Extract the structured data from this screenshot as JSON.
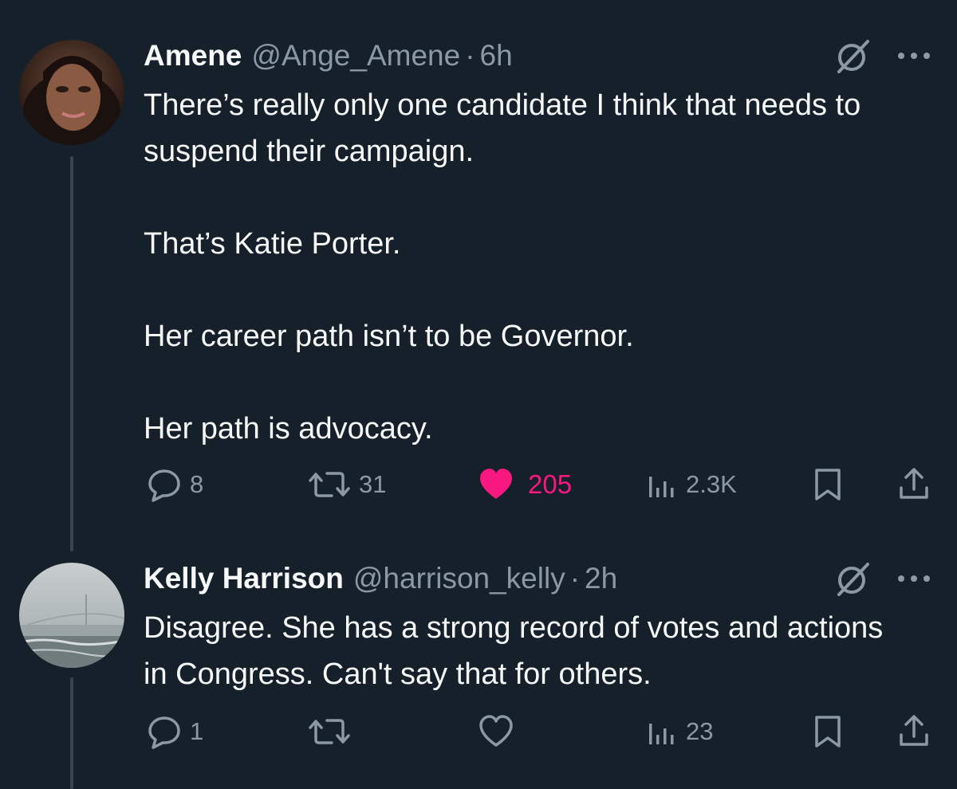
{
  "tweets": [
    {
      "name": "Amene",
      "handle": "@Ange_Amene",
      "separator": "·",
      "time": "6h",
      "paragraphs": [
        "There’s really only one candidate I think that needs to suspend their campaign.",
        "That’s Katie Porter.",
        "Her career path isn’t to be Governor.",
        "Her path is advocacy."
      ],
      "replies": "8",
      "reposts": "31",
      "likes": "205",
      "liked": true,
      "views": "2.3K"
    },
    {
      "name": "Kelly Harrison",
      "handle": "@harrison_kelly",
      "separator": "·",
      "time": "2h",
      "paragraphs": [
        "Disagree. She has a strong record of votes and actions in Congress. Can't say that for others."
      ],
      "replies": "1",
      "reposts": "",
      "likes": "",
      "liked": false,
      "views": "23"
    }
  ],
  "colors": {
    "background": "#15202b",
    "text": "#f7f9f9",
    "muted": "#8b98a5",
    "like": "#f91880",
    "thread_line": "#38444d"
  },
  "icons": [
    "grok-icon",
    "more-icon",
    "reply-icon",
    "repost-icon",
    "heart-filled-icon",
    "heart-icon",
    "views-icon",
    "bookmark-icon",
    "share-icon"
  ]
}
